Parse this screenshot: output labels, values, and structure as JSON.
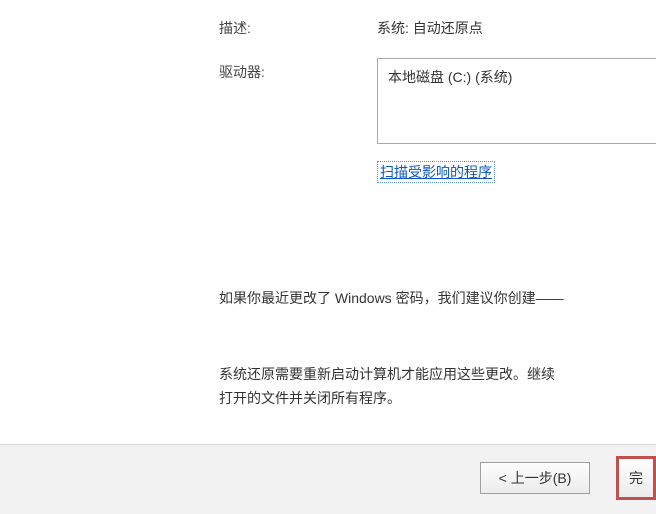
{
  "labels": {
    "description": "描述:",
    "drive": "驱动器:"
  },
  "values": {
    "description": "系统: 自动还原点",
    "drive_item": "本地磁盘 (C:) (系统)"
  },
  "links": {
    "scan_affected": "扫描受影响的程序"
  },
  "notes": {
    "password_note": "如果你最近更改了 Windows 密码，我们建议你创建——",
    "restart_note_line1": "系统还原需要重新启动计算机才能应用这些更改。继续",
    "restart_note_line2": "打开的文件并关闭所有程序。"
  },
  "buttons": {
    "back": "< 上一步(B)",
    "next_partial": "完"
  }
}
